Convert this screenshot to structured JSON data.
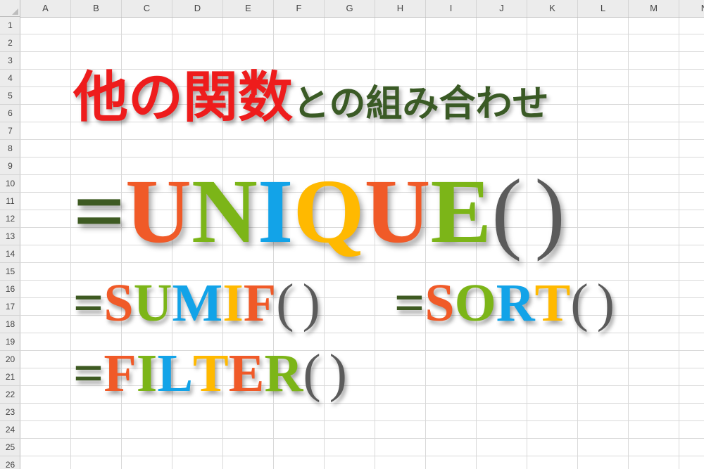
{
  "sheet": {
    "columns": [
      "A",
      "B",
      "C",
      "D",
      "E",
      "F",
      "G",
      "H",
      "I",
      "J",
      "K",
      "L",
      "M",
      "N"
    ],
    "rows": [
      "1",
      "2",
      "3",
      "4",
      "5",
      "6",
      "7",
      "8",
      "9",
      "10",
      "11",
      "12",
      "13",
      "14",
      "15",
      "16",
      "17",
      "18",
      "19",
      "20",
      "21",
      "22",
      "23",
      "24",
      "25",
      "26"
    ]
  },
  "title": {
    "main": "他の関数",
    "sub": "との組み合わせ",
    "main_color": "#ee1c1c",
    "sub_color": "#3a5a25"
  },
  "formulas": {
    "unique": {
      "eq": "=",
      "letters": [
        "U",
        "N",
        "I",
        "Q",
        "U",
        "E"
      ],
      "paren_open": "(",
      "paren_close": ")"
    },
    "sumif": {
      "eq": "=",
      "letters": [
        "S",
        "U",
        "M",
        "I",
        "F"
      ],
      "paren_open": "(",
      "paren_close": ")"
    },
    "sort": {
      "eq": "=",
      "letters": [
        "S",
        "O",
        "R",
        "T"
      ],
      "paren_open": "(",
      "paren_close": ")"
    },
    "filter": {
      "eq": "=",
      "letters": [
        "F",
        "I",
        "L",
        "T",
        "E",
        "R"
      ],
      "paren_open": "(",
      "paren_close": ")"
    }
  },
  "colors": {
    "orange": "#f05a28",
    "green": "#7cb518",
    "blue": "#12a3e8",
    "yellow": "#ffb900",
    "eq_green": "#3e5a22",
    "paren_gray": "#5b5b5b"
  }
}
